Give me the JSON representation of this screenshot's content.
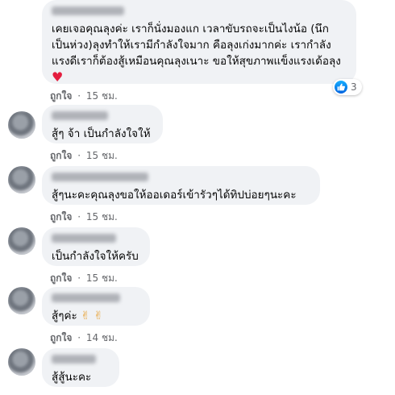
{
  "comments": [
    {
      "author": "",
      "text_lines": [
        "เคยเจอคุณลุงค่ะ เราก็นั่งมองแก เวลาขับรถจะเป็นไงน้อ (นึก",
        "เป็นห่วง)ลุงทำให้เรามีกำลังใจมาก คือลุงเก่งมากค่ะ เรากำลัง",
        "แรงดีเราก็ต้องสู้เหมือนคุณลุงเนาะ ขอให้สุขภาพแข็งแรงเด้อลุง"
      ],
      "emoji": "♥",
      "reaction_count": "3",
      "like_label": "ถูกใจ",
      "time": "15 ชม."
    },
    {
      "author": "",
      "text": "สู้ๆ จ้า เป็นกำลังใจให้",
      "like_label": "ถูกใจ",
      "time": "15 ชม."
    },
    {
      "author": "",
      "text": "สู้ๆนะคะคุณลุงขอให้ออเดอร์เข้ารัวๆได้ทิปบ่อยๆนะคะ",
      "like_label": "ถูกใจ",
      "time": "15 ชม."
    },
    {
      "author": "",
      "text": "เป็นกำลังใจให้ครับ",
      "like_label": "ถูกใจ",
      "time": "15 ชม."
    },
    {
      "author": "",
      "text": "สู้ๆค่ะ",
      "emoji": "✌ ✌",
      "like_label": "ถูกใจ",
      "time": "14 ชม."
    },
    {
      "author": "",
      "text": "สู้สู้นะคะ"
    }
  ],
  "separator": "·",
  "icons": {
    "reaction": "like-icon",
    "heart": "heart-icon",
    "peace": "victory-hand-icon"
  },
  "colors": {
    "bubble": "#f0f2f5",
    "meta_text": "#65676b",
    "like_blue": "#1877f2",
    "heart": "#e41e3f"
  }
}
